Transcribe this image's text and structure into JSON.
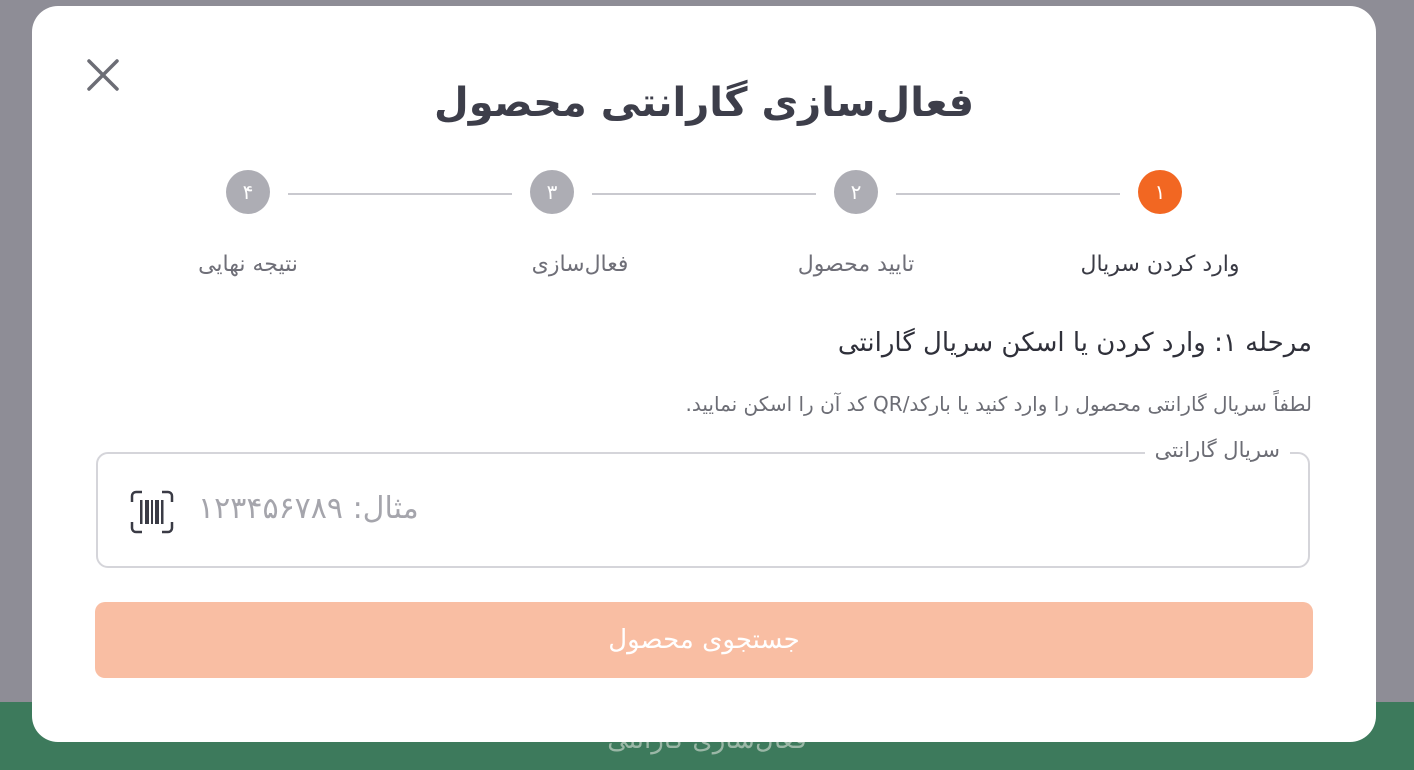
{
  "background": {
    "bar_text": "فعال‌سازی گارانتی",
    "colors": {
      "overlay": "#8e8d96",
      "bar": "#3d7a5c"
    }
  },
  "modal": {
    "title": "فعال‌سازی گارانتی محصول",
    "close_icon": "close-icon",
    "steps": [
      {
        "number": "۱",
        "label": "وارد کردن سریال",
        "active": true
      },
      {
        "number": "۲",
        "label": "تایید محصول",
        "active": false
      },
      {
        "number": "۳",
        "label": "فعال‌سازی",
        "active": false
      },
      {
        "number": "۴",
        "label": "نتیجه نهایی",
        "active": false
      }
    ],
    "step_heading": "مرحله ۱: وارد کردن یا اسکن سریال گارانتی",
    "step_description": "لطفاً سریال گارانتی محصول را وارد کنید یا بارکد/QR کد آن را اسکن نمایید.",
    "serial_field": {
      "label": "سریال گارانتی",
      "placeholder": "مثال: ۱۲۳۴۵۶۷۸۹",
      "value": "",
      "scan_icon": "barcode-scan-icon"
    },
    "search_button": {
      "label": "جستجوی محصول",
      "enabled": false
    },
    "colors": {
      "accent": "#f26722",
      "inactive_step": "#adadb4",
      "button_disabled": "#f9bea3"
    }
  }
}
